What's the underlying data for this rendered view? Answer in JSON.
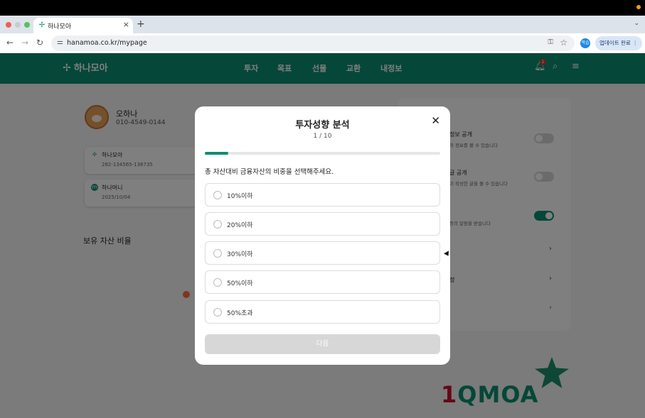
{
  "browser": {
    "tab_title": "하나모아",
    "tab_close": "×",
    "new_tab": "+",
    "url": "hanamoa.co.kr/mypage",
    "profile_label": "학습",
    "update_label": "업데이트 완료",
    "update_menu": "⋮"
  },
  "site": {
    "logo_text": "하나모아",
    "nav": [
      "투자",
      "목표",
      "선물",
      "교환",
      "내정보"
    ],
    "notification_count": "1"
  },
  "profile": {
    "name": "오하나",
    "phone": "010-4549-0144",
    "accounts": [
      {
        "name": "하나모아",
        "number": "282-134565-136735"
      },
      {
        "name": "하나머니",
        "number": "2025/10/04"
      }
    ],
    "asset_ratio_title": "보유 자산 비율"
  },
  "settings_partial": {
    "row1_label": "정보 공개",
    "row1_desc": "의 정보를 볼 수 있습니다",
    "row2_label": "글 공개",
    "row2_desc": "이 작성한 글을 볼 수 있습니다",
    "row3_desc": "등의 알림을 받습니다",
    "row5_label": "정"
  },
  "banner": {
    "text_one": "1",
    "text_rest": "QMOA"
  },
  "modal": {
    "title": "투자성향 분석",
    "close": "✕",
    "step": "1 / 10",
    "progress": 0.1,
    "question": "총 자산대비 금융자산의 비중을 선택해주세요.",
    "options": [
      "10%이하",
      "20%이하",
      "30%이하",
      "50%이하",
      "50%초과"
    ],
    "next_label": "다음"
  },
  "colors": {
    "brand": "#0a8f73",
    "alert": "#e53935"
  }
}
